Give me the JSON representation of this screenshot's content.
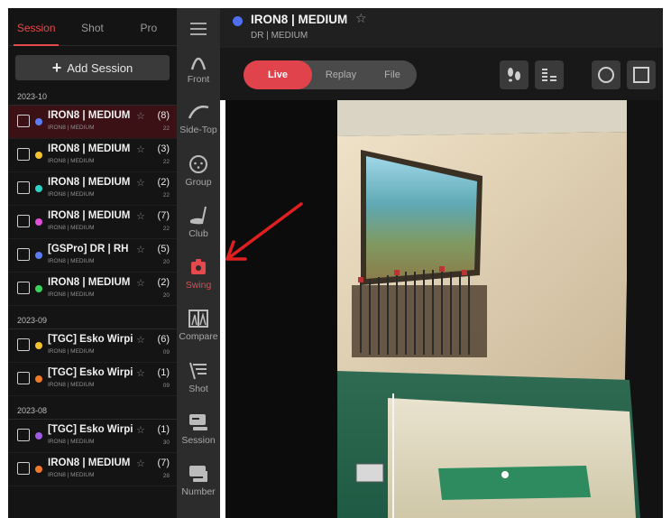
{
  "tabs": [
    "Session",
    "Shot",
    "Pro"
  ],
  "add_session_label": "Add Session",
  "groups": [
    {
      "label": "2023-10",
      "rows": [
        {
          "name": "IRON8 | MEDIUM",
          "sub": "IRON8 | MEDIUM",
          "count": "(8)",
          "num": "22",
          "color": "#5b7cf5",
          "selected": true
        },
        {
          "name": "IRON8 | MEDIUM",
          "sub": "IRON8 | MEDIUM",
          "count": "(3)",
          "num": "22",
          "color": "#f2c230",
          "selected": false
        },
        {
          "name": "IRON8 | MEDIUM",
          "sub": "IRON8 | MEDIUM",
          "count": "(2)",
          "num": "22",
          "color": "#2fd1c6",
          "selected": false
        },
        {
          "name": "IRON8 | MEDIUM",
          "sub": "IRON8 | MEDIUM",
          "count": "(7)",
          "num": "22",
          "color": "#e04fd6",
          "selected": false
        },
        {
          "name": "[GSPro] DR | RH",
          "sub": "IRON8 | MEDIUM",
          "count": "(5)",
          "num": "20",
          "color": "#5b7cf5",
          "selected": false
        },
        {
          "name": "IRON8 | MEDIUM",
          "sub": "IRON8 | MEDIUM",
          "count": "(2)",
          "num": "20",
          "color": "#3ad45a",
          "selected": false
        }
      ]
    },
    {
      "label": "2023-09",
      "rows": [
        {
          "name": "[TGC] Esko Wirpi",
          "sub": "IRON8 | MEDIUM",
          "count": "(6)",
          "num": "09",
          "color": "#f2c230",
          "selected": false
        },
        {
          "name": "[TGC] Esko Wirpi",
          "sub": "IRON8 | MEDIUM",
          "count": "(1)",
          "num": "09",
          "color": "#f07a2a",
          "selected": false
        }
      ]
    },
    {
      "label": "2023-08",
      "rows": [
        {
          "name": "[TGC] Esko Wirpi",
          "sub": "IRON8 | MEDIUM",
          "count": "(1)",
          "num": "30",
          "color": "#a05be0",
          "selected": false
        },
        {
          "name": "IRON8 | MEDIUM",
          "sub": "IRON8 | MEDIUM",
          "count": "(7)",
          "num": "28",
          "color": "#f07a2a",
          "selected": false
        }
      ]
    }
  ],
  "nav": [
    {
      "label": "Front",
      "icon": "front-arc-icon",
      "active": false
    },
    {
      "label": "Side-Top",
      "icon": "side-top-arc-icon",
      "active": false
    },
    {
      "label": "Group",
      "icon": "group-face-icon",
      "active": false
    },
    {
      "label": "Club",
      "icon": "club-icon",
      "active": false
    },
    {
      "label": "Swing",
      "icon": "swing-camera-icon",
      "active": true
    },
    {
      "label": "Compare",
      "icon": "compare-icon",
      "active": false
    },
    {
      "label": "Shot",
      "icon": "shot-icon",
      "active": false
    },
    {
      "label": "Session",
      "icon": "session-icon",
      "active": false
    },
    {
      "label": "Number",
      "icon": "number-icon",
      "active": false
    }
  ],
  "header": {
    "title": "IRON8 | MEDIUM",
    "subtitle": "DR | MEDIUM",
    "dot_color": "#4f6ff0"
  },
  "mode": {
    "live": "Live",
    "replay": "Replay",
    "file": "File"
  },
  "toolbar_icons": [
    "footprints-icon",
    "bars-icon",
    "circle-icon",
    "square-icon"
  ],
  "colors": {
    "accent": "#e5484d",
    "arrow": "#e02020"
  }
}
